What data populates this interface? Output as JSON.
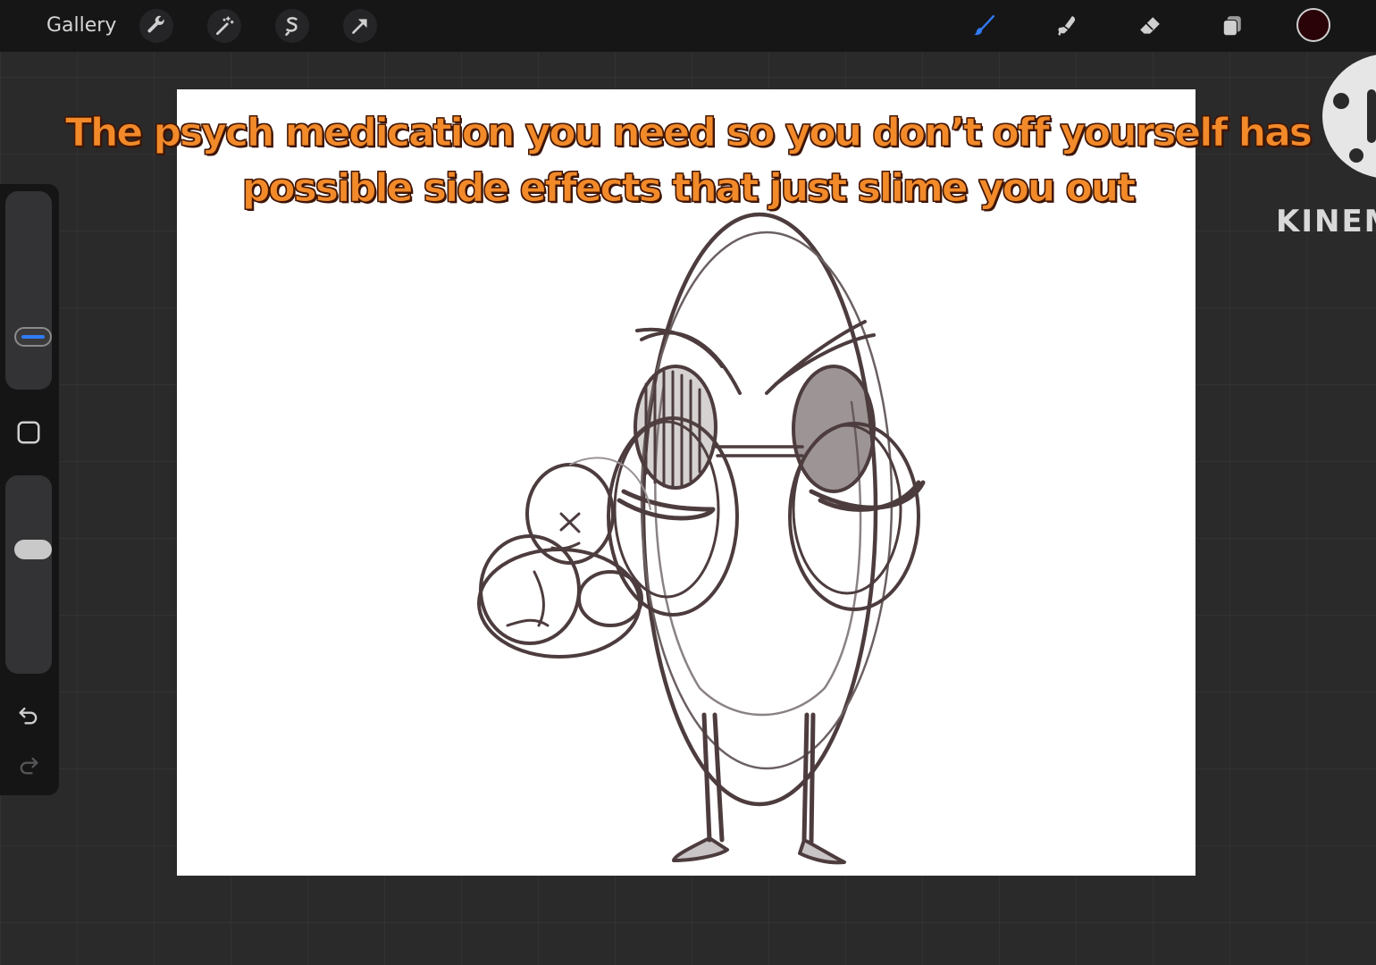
{
  "toolbar": {
    "gallery_label": "Gallery",
    "left_icons": [
      "wrench-icon",
      "magic-wand-icon",
      "selection-icon",
      "transform-arrow-icon"
    ],
    "right_icons": [
      "brush-icon",
      "smudge-icon",
      "eraser-icon",
      "layers-icon"
    ],
    "active_tool": "brush-icon",
    "current_color": "#2a0309",
    "accent_color": "#2f7cf6"
  },
  "sidebar": {
    "brush_size_level": 0.7,
    "opacity_level": 0.35,
    "modify_button": "square-modify-icon",
    "undo": "undo-icon",
    "redo": "redo-icon"
  },
  "caption": {
    "line1": "The psych medication you need so you don’t off yourself has",
    "line2": "possible side effects that just slime you out"
  },
  "watermark": {
    "text": "KINEM"
  }
}
